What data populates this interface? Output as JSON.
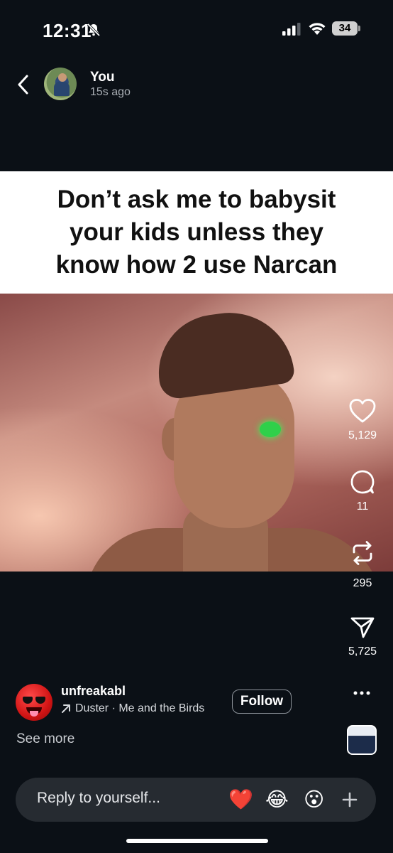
{
  "status_bar": {
    "time": "12:31",
    "battery": "34"
  },
  "header": {
    "user_name": "You",
    "post_time": "15s ago"
  },
  "meme": {
    "caption": "Don’t ask me to babysit\nyour kids unless they\nknow how 2 use Narcan"
  },
  "actions": {
    "likes": "5,129",
    "comments": "11",
    "reposts": "295",
    "shares": "5,725"
  },
  "author": {
    "name": "unfreakabl",
    "music": "Duster · Me and the Birds",
    "follow_label": "Follow",
    "see_more": "See more"
  },
  "reply": {
    "placeholder": "Reply to yourself...",
    "reactions": [
      "❤️",
      "😂",
      "😮"
    ]
  },
  "colors": {
    "background": "#0b1016",
    "reply_bar": "#262b31",
    "heart": "#ff2b3a"
  },
  "icons": [
    "bell-muted-icon",
    "signal-icon",
    "wifi-icon",
    "back-icon",
    "heart-icon",
    "comment-icon",
    "repost-icon",
    "send-icon",
    "arrow-icon",
    "more-icon",
    "plus-icon"
  ]
}
